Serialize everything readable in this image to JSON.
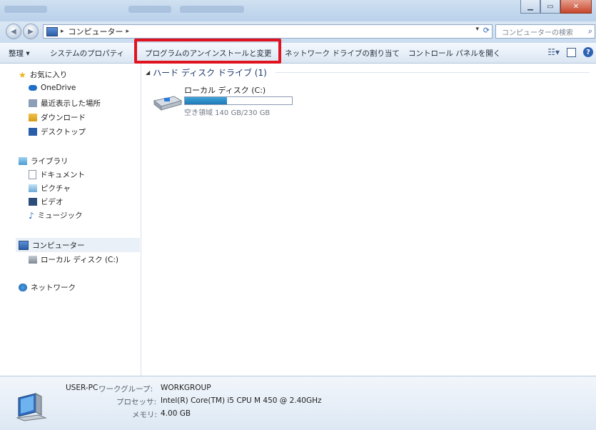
{
  "window": {
    "title_blur": ""
  },
  "address": {
    "segment": "コンピューター",
    "search_placeholder": "コンピューターの検索"
  },
  "toolbar": {
    "organize": "整理 ▾",
    "system_properties": "システムのプロパティ",
    "uninstall": "プログラムのアンインストールと変更",
    "map_drive": "ネットワーク ドライブの割り当て",
    "control_panel": "コントロール パネルを開く",
    "highlight_color": "#e0131f"
  },
  "sidebar": {
    "favorites": "お気に入り",
    "onedrive": "OneDrive",
    "recent": "最近表示した場所",
    "downloads": "ダウンロード",
    "desktop": "デスクトップ",
    "libraries": "ライブラリ",
    "documents": "ドキュメント",
    "pictures": "ピクチャ",
    "videos": "ビデオ",
    "music": "ミュージック",
    "computer": "コンピューター",
    "local_disk": "ローカル ディスク (C:)",
    "network": "ネットワーク"
  },
  "main": {
    "group_header": "ハード ディスク ドライブ (1)",
    "drive_name": "ローカル ディスク (C:)",
    "drive_free": "空き領域 140 GB/230 GB",
    "drive_used_fraction": 0.39
  },
  "details": {
    "pc_name": "USER-PC",
    "workgroup_label": "ワークグループ:",
    "workgroup_value": "WORKGROUP",
    "processor_label": "プロセッサ:",
    "processor_value": "Intel(R) Core(TM) i5 CPU      M 450  @ 2.40GHz",
    "memory_label": "メモリ:",
    "memory_value": "4.00 GB"
  }
}
